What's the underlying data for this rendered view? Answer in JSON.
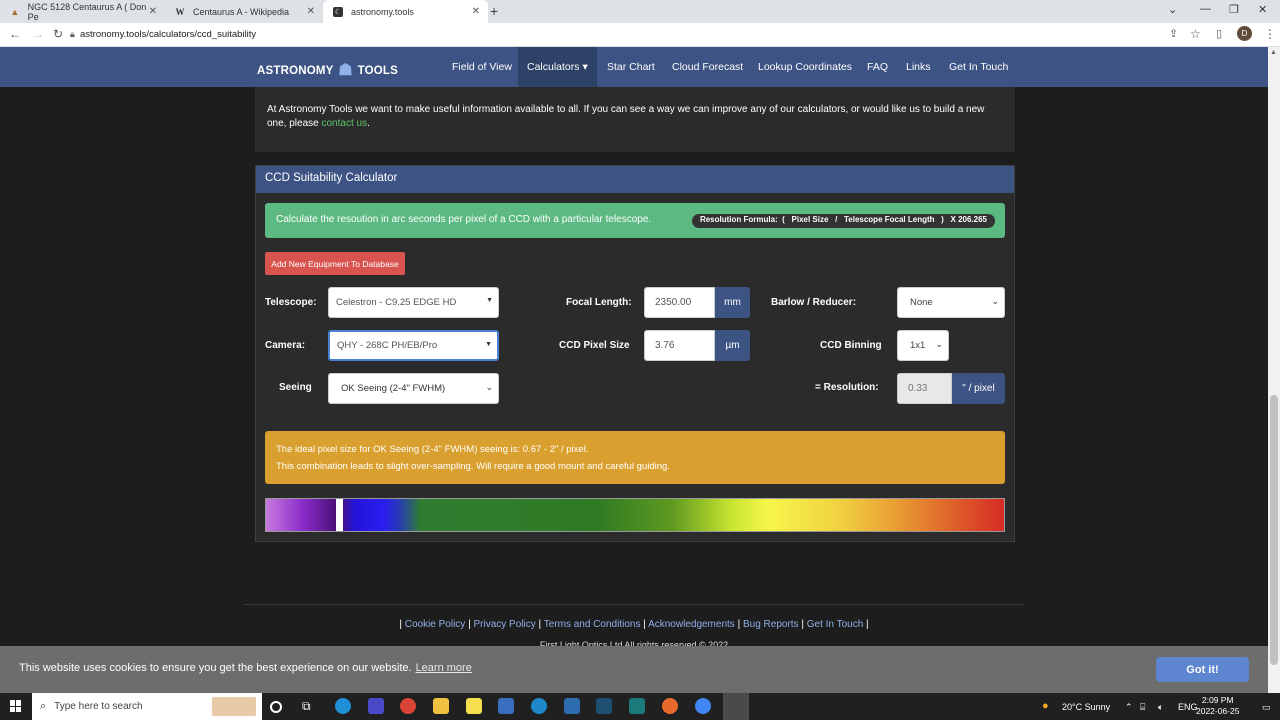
{
  "browser": {
    "tabs": [
      {
        "title": "NGC 5128 Centaurus A ( Don Pe",
        "active": false
      },
      {
        "title": "Centaurus A - Wikipedia",
        "active": false
      },
      {
        "title": "astronomy.tools",
        "active": true
      }
    ],
    "new_tab": "+",
    "url": "astronomy.tools/calculators/ccd_suitability",
    "profile_initial": "D"
  },
  "site": {
    "logo_left": "ASTRONOMY",
    "logo_right": "TOOLS",
    "nav": [
      {
        "label": "Field of View"
      },
      {
        "label": "Calculators ▾"
      },
      {
        "label": "Star Chart"
      },
      {
        "label": "Cloud Forecast"
      },
      {
        "label": "Lookup Coordinates"
      },
      {
        "label": "FAQ"
      },
      {
        "label": "Links"
      },
      {
        "label": "Get In Touch"
      }
    ]
  },
  "info": {
    "text_before": "At Astronomy Tools we want to make useful information available to all. If you can see a way we can improve any of our calculators, or would like us to build a new one, please ",
    "link": "contact us",
    "text_after": "."
  },
  "calculator": {
    "title": "CCD Suitability Calculator",
    "description": "Calculate the resoution in arc seconds per pixel of a CCD with a particular telescope.",
    "formula": "Resolution Formula:  (   Pixel Size   /   Telescope Focal Length   )   X 206.265",
    "add_button": "Add New Equipment To Database",
    "telescope_label": "Telescope:",
    "telescope_value": "Celestron - C9.25 EDGE HD",
    "camera_label": "Camera:",
    "camera_value": "QHY - 268C PH/EB/Pro",
    "seeing_label": "Seeing",
    "seeing_value": "OK Seeing (2-4\" FWHM)",
    "focal_label": "Focal Length:",
    "focal_value": "2350.00",
    "focal_unit": "mm",
    "pixel_label": "CCD Pixel Size",
    "pixel_value": "3.76",
    "pixel_unit": "µm",
    "barlow_label": "Barlow / Reducer:",
    "barlow_value": "None",
    "binning_label": "CCD Binning",
    "binning_value": "1x1",
    "resolution_label": "=  Resolution:",
    "resolution_value": "0.33",
    "resolution_unit": "\" / pixel",
    "warning_line1": "The ideal pixel size for OK Seeing (2-4\" FWHM) seeing is: 0.67 - 2\" / pixel.",
    "warning_line2": "This combination leads to slight over-sampling. Will require a good mount and careful guiding.",
    "colors": {
      "header": "#3c5384",
      "info": "#5cb982",
      "warning": "#daa02f",
      "danger": "#d9534f"
    }
  },
  "footer": {
    "sep": "|",
    "links": [
      "Cookie Policy",
      "Privacy Policy",
      "Terms and Conditions",
      "Acknowledgements",
      "Bug Reports",
      "Get In Touch"
    ],
    "copyright": "First Light Optics Ltd All rights reserved © 2022"
  },
  "cookie": {
    "text": "This website uses cookies to ensure you get the best experience on our website.",
    "link": "Learn more",
    "button": "Got it!"
  },
  "taskbar": {
    "search_placeholder": "Type here to search",
    "weather": "20°C  Sunny",
    "lang": "ENG",
    "time": "2:09 PM",
    "date": "2022-06-25"
  }
}
